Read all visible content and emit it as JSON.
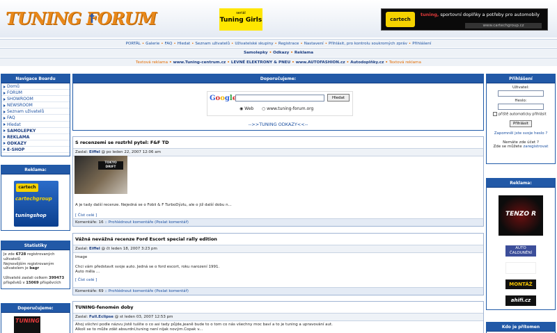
{
  "header": {
    "logo": "TUNING FORUM",
    "banner_small": {
      "sub": "seriál",
      "title": "Tuning Girls"
    },
    "banner_right": {
      "logo": "cartech",
      "tag_red": "tuning,",
      "tag": " sportovní doplňky a potřeby pro automobily",
      "url": "www.cartechgroup.cz"
    }
  },
  "nav1": [
    "PORTÁL",
    "Galerie",
    "FAQ",
    "Hledat",
    "Seznam uživatelů",
    "Uživatelské skupiny",
    "Registrace",
    "Nastavení",
    "Přihlásit, pro kontrolu soukromých zpráv",
    "Přihlášení"
  ],
  "nav2": [
    "Samolepky",
    "Odkazy",
    "Reklama"
  ],
  "nav3": [
    "Textová reklama",
    "www.Tuning-centrum.cz",
    "LEVNÉ ELEKTRONY & PNEU",
    "www.AUTOFASHION.cz",
    "Autodoplňky.cz",
    "Textová reklama"
  ],
  "sidebar": {
    "title": "Navigace Boardu",
    "items": [
      "Domů",
      "FORUM",
      "SHOWROOM",
      "NEWSROOM",
      "Seznam uživatelů",
      "FAQ",
      "Hledat",
      "SAMOLEPKY",
      "REKLAMA",
      "ODKAZY",
      "E-SHOP"
    ],
    "ad_title": "Reklama:",
    "ad_logo": "cartech",
    "ad_url": "cartechgroup",
    "ad_shop": "tuningshop",
    "stats_title": "Statistiky",
    "stats_text1": "Je zde ",
    "stats_users": "6728",
    "stats_text2": " registrovaných uživatelů",
    "stats_text3": "Nejnovějším registrovaným uživatelem je ",
    "stats_newest": "bagr",
    "stats_text4": "Uživatelé zaslali celkem ",
    "stats_posts": "399473",
    "stats_text5": " příspěvků v ",
    "stats_threads": "15069",
    "stats_text6": " příspěvcích",
    "rec_title": "Doporučujeme:",
    "rec_logo": "TUNING"
  },
  "center": {
    "title": "Doporučujeme:",
    "google_button": "Hledat",
    "radio_web": "Web",
    "radio_site": "www.tuning-forum.org",
    "links": "-->>TUNING ODKAZY<<--"
  },
  "articles": [
    {
      "title": "S recenzemi se roztrhl pytel: F&F TD",
      "author": "Eiffel",
      "date": " @ po leden 22, 2007 12:06 am",
      "body": "A je tady další recenze. Nejedná se o Fobii & F TurboDýzlu, ale o již další dobu n...",
      "read": "Číst celé",
      "comments": "16",
      "see": "Prohlédnout komentáře",
      "post": "Poslat komentář"
    },
    {
      "title": "Vážná nevážná recenze Ford Escort special rally edition",
      "author": "Eiffel",
      "date": " @ čt leden 18, 2007 3:23 pm",
      "body": "Image",
      "body2": "Chci vám představit svoje auto. Jedná se o ford escort, roku narození 1991.",
      "body3": "Auto měla ...",
      "read": "Číst celé",
      "comments": "69",
      "see": "Prohlédnout komentáře",
      "post": "Poslat komentář"
    },
    {
      "title": "TUNING-fenomén doby",
      "author": "Full.Eclipse",
      "date": " @ st leden 03, 2007 12:53 pm",
      "body": "Ahoj všichni podle názvu jistě tušíte o co asi tady půjde,jeaně bude to o tom co nás všechny moc baví a to je tuning a upravování aut.",
      "body2": "Alkoli se to může zdát absurdní,tuning není nijak novým.Copak v..."
    }
  ],
  "login": {
    "title": "Přihlášení",
    "user_label": "Uživatel:",
    "pass_label": "Heslo:",
    "auto_label": "přiště automaticky přihlásit",
    "button": "Přihlásit",
    "forgot": "Zapomněl jste svoje heslo ?",
    "no_account": "Nemáte zde účet ?",
    "register_text": "Zde se můžete ",
    "register_link": "zaregistrovat"
  },
  "right_ads": {
    "title": "Reklama:",
    "tenzo": "TENZO R",
    "auto": "AUTO ČALOUNĚNÍ",
    "montaz": "MONTÁŽ",
    "ahifi": "ahifi.cz"
  },
  "who": {
    "title": "Kdo je přítomen"
  },
  "colors": {
    "header_blue": "#2259a7",
    "orange": "#e8881a",
    "link": "#1a4fa0"
  }
}
